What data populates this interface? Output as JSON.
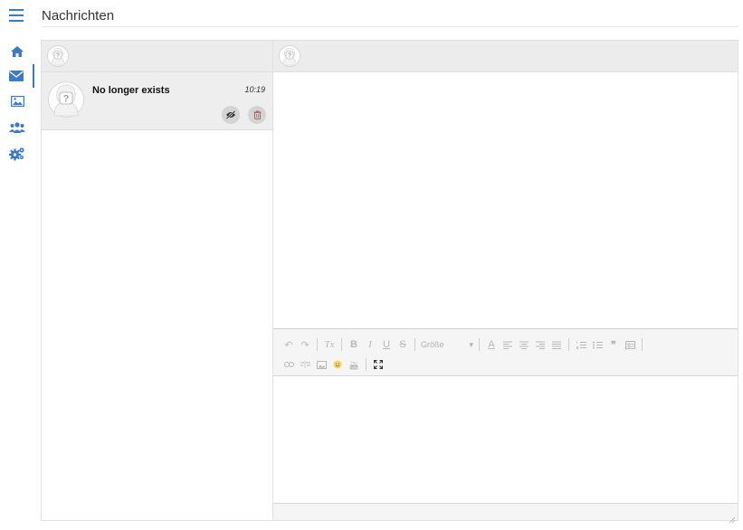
{
  "header": {
    "title": "Nachrichten"
  },
  "sidebar": {
    "items": [
      {
        "name": "home",
        "icon": "home-icon"
      },
      {
        "name": "messages",
        "icon": "envelope-icon",
        "active": true
      },
      {
        "name": "gallery",
        "icon": "image-icon"
      },
      {
        "name": "users",
        "icon": "users-icon"
      },
      {
        "name": "settings",
        "icon": "gears-icon"
      }
    ]
  },
  "conversation": {
    "name": "No longer exists",
    "time": "10:19",
    "actions": [
      {
        "icon": "eye-slash-icon"
      },
      {
        "icon": "trash-icon"
      }
    ]
  },
  "editor": {
    "size_label": "Größe",
    "size_arrow": "▾",
    "font_color_label": "A",
    "bold": "B",
    "italic": "I",
    "underline": "U",
    "strike": "S",
    "clear_format": "Tx",
    "quote": "❞",
    "undo": "↶",
    "redo": "↷"
  },
  "colors": {
    "accent": "#3c7ac6",
    "panel_header": "#ececec",
    "toolbar_bg": "#f5f5f5"
  }
}
